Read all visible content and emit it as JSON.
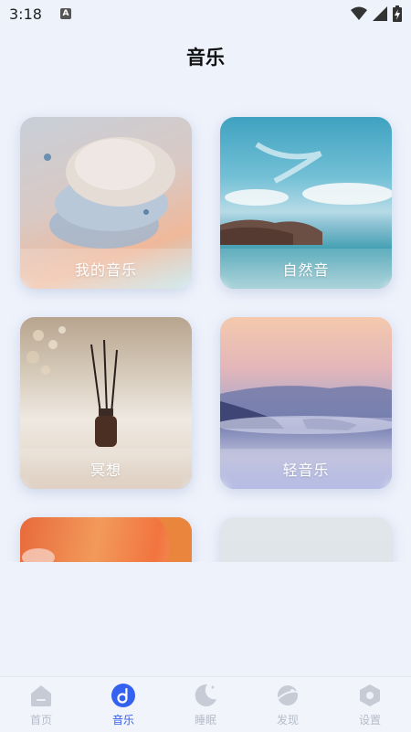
{
  "status": {
    "time": "3:18",
    "notification_glyph": "A"
  },
  "page": {
    "title": "音乐"
  },
  "cards": [
    {
      "label": "我的音乐",
      "icon": "abstract-shapes-image"
    },
    {
      "label": "自然音",
      "icon": "seascape-image"
    },
    {
      "label": "冥想",
      "icon": "incense-diffuser-image"
    },
    {
      "label": "轻音乐",
      "icon": "misty-mountains-image"
    },
    {
      "label": "",
      "icon": "orange-abstract-image"
    },
    {
      "label": "",
      "icon": "grey-placeholder-image"
    }
  ],
  "tabs": [
    {
      "label": "首页",
      "icon": "home-icon",
      "active": false
    },
    {
      "label": "音乐",
      "icon": "music-icon",
      "active": true
    },
    {
      "label": "睡眠",
      "icon": "moon-icon",
      "active": false
    },
    {
      "label": "发现",
      "icon": "planet-icon",
      "active": false
    },
    {
      "label": "设置",
      "icon": "hexagon-settings-icon",
      "active": false
    }
  ],
  "colors": {
    "accent": "#3561f0",
    "inactive": "#b7bcc8",
    "background": "#eef2fb"
  }
}
